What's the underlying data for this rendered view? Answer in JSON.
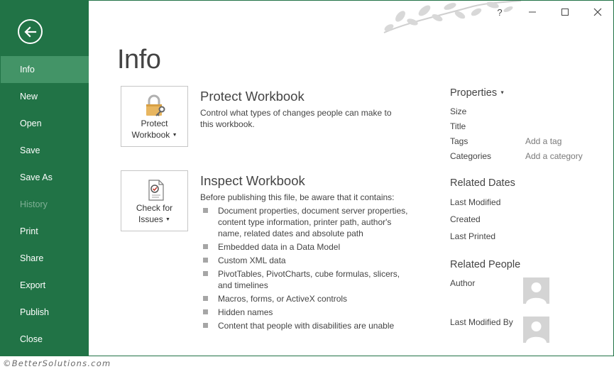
{
  "window": {
    "help_label": "?",
    "minimize_glyph": "—",
    "close_glyph": "✕"
  },
  "sidebar": {
    "items": [
      {
        "label": "Info",
        "active": true
      },
      {
        "label": "New"
      },
      {
        "label": "Open"
      },
      {
        "label": "Save"
      },
      {
        "label": "Save As"
      },
      {
        "label": "History",
        "disabled": true
      },
      {
        "label": "Print"
      },
      {
        "label": "Share"
      },
      {
        "label": "Export"
      },
      {
        "label": "Publish"
      },
      {
        "label": "Close"
      }
    ]
  },
  "main": {
    "title": "Info",
    "protect": {
      "button_line1": "Protect",
      "button_line2": "Workbook",
      "title": "Protect Workbook",
      "description": "Control what types of changes people can make to this workbook."
    },
    "inspect": {
      "button_line1": "Check for",
      "button_line2": "Issues",
      "title": "Inspect Workbook",
      "description": "Before publishing this file, be aware that it contains:",
      "items": [
        "Document properties, document server properties, content type information, printer path, author's name, related dates and absolute path",
        "Embedded data in a Data Model",
        "Custom XML data",
        "PivotTables, PivotCharts, cube formulas, slicers, and timelines",
        "Macros, forms, or ActiveX controls",
        "Hidden names",
        "Content that people with disabilities are unable"
      ]
    }
  },
  "properties": {
    "header": "Properties",
    "size_label": "Size",
    "title_label": "Title",
    "tags_label": "Tags",
    "tags_placeholder": "Add a tag",
    "categories_label": "Categories",
    "categories_placeholder": "Add a category",
    "related_dates": {
      "title": "Related Dates",
      "last_modified": "Last Modified",
      "created": "Created",
      "last_printed": "Last Printed"
    },
    "related_people": {
      "title": "Related People",
      "author": "Author",
      "last_modified_by": "Last Modified By"
    }
  },
  "colors": {
    "accent": "#217346",
    "active_item": "#439467",
    "lock_body": "#e8b660"
  },
  "watermark": "©BetterSolutions.com"
}
